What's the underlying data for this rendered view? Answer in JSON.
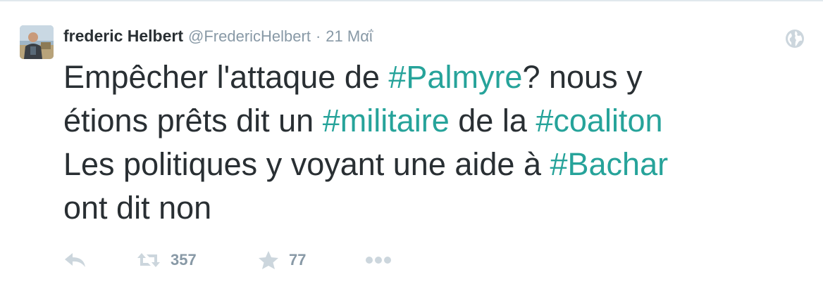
{
  "author": {
    "name": "frederic Helbert",
    "handle": "@FredericHelbert",
    "separator": "·",
    "date": "21 Μαΐ"
  },
  "tweet": {
    "lines": [
      [
        {
          "text": "Empêcher l'attaque de ",
          "hashtag": false
        },
        {
          "text": "#Palmyre",
          "hashtag": true
        },
        {
          "text": "? nous y",
          "hashtag": false
        }
      ],
      [
        {
          "text": "étions prêts dit un ",
          "hashtag": false
        },
        {
          "text": "#militaire",
          "hashtag": true
        },
        {
          "text": " de la ",
          "hashtag": false
        },
        {
          "text": "#coaliton",
          "hashtag": true
        }
      ],
      [
        {
          "text": "Les politiques y voyant une aide à ",
          "hashtag": false
        },
        {
          "text": "#Bachar",
          "hashtag": true
        }
      ],
      [
        {
          "text": "ont dit non",
          "hashtag": false
        }
      ]
    ]
  },
  "actions": {
    "retweet_count": "357",
    "favorite_count": "77"
  },
  "colors": {
    "text": "#292f33",
    "muted": "#8899a6",
    "hashtag": "#26a39a",
    "icon": "#ccd6dd",
    "border": "#e1e8ed"
  },
  "icons": [
    "avatar",
    "globe-icon",
    "reply-icon",
    "retweet-icon",
    "favorite-icon",
    "more-icon"
  ]
}
